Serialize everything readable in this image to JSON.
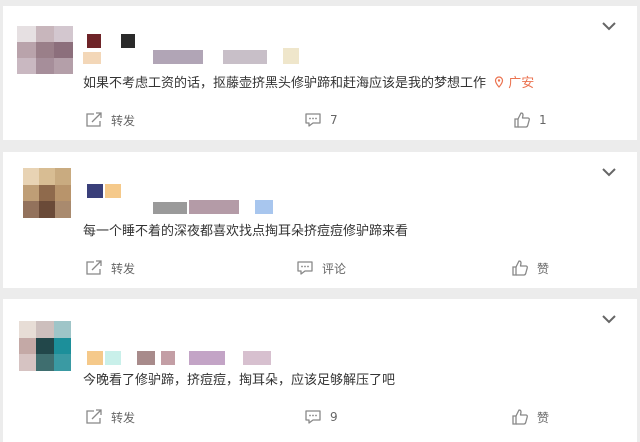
{
  "comments": [
    {
      "text": "如果不考虑工资的话，抠藤壶挤黑头修驴蹄和赶海应该是我的梦想工作",
      "location": "广安",
      "actions": {
        "repost": "转发",
        "comment_count": "7",
        "like_count": "1"
      }
    },
    {
      "text": "每一个睡不着的深夜都喜欢找点掏耳朵挤痘痘修驴蹄来看",
      "actions": {
        "repost": "转发",
        "comment": "评论",
        "like": "赞"
      }
    },
    {
      "text": "今晚看了修驴蹄，挤痘痘，掏耳朵，应该足够解压了吧",
      "actions": {
        "repost": "转发",
        "comment_count": "9",
        "like": "赞"
      }
    }
  ],
  "icons": {
    "menu": "chevron-down-icon",
    "repost": "share-icon",
    "comment": "comment-icon",
    "like": "thumbs-up-icon",
    "location": "location-pin-icon"
  },
  "colors": {
    "background": "#ececec",
    "card": "#ffffff",
    "text": "#333333",
    "muted": "#666666",
    "location": "#eb7350"
  }
}
